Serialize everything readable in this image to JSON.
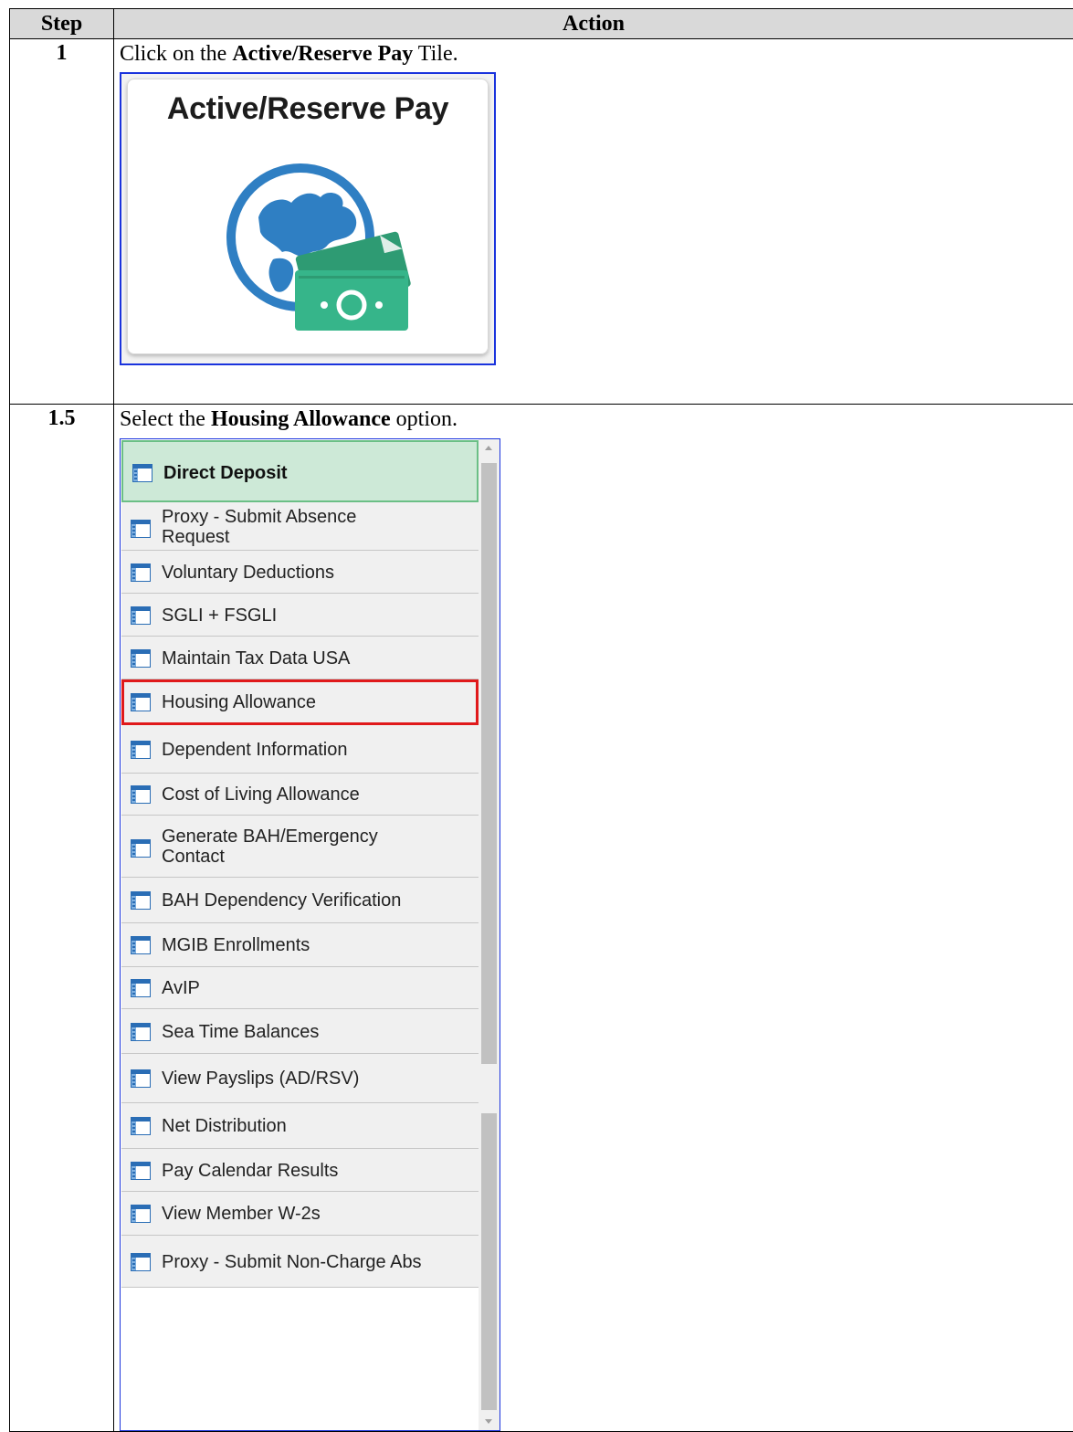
{
  "table": {
    "headers": {
      "step": "Step",
      "action": "Action"
    },
    "rows": [
      {
        "step": "1",
        "instruction": {
          "prefix": "Click on the ",
          "bold": "Active/Reserve Pay",
          "suffix": " Tile."
        },
        "tile": {
          "title": "Active/Reserve Pay",
          "icon": "globe-money-icon"
        }
      },
      {
        "step": "1.5",
        "instruction": {
          "prefix": "Select the ",
          "bold": "Housing Allowance",
          "suffix": " option."
        },
        "menu": {
          "items": [
            {
              "line1": "Direct Deposit",
              "line2": ""
            },
            {
              "line1": "Proxy - Submit Absence",
              "line2": "Request"
            },
            {
              "line1": "Voluntary Deductions",
              "line2": ""
            },
            {
              "line1": "SGLI + FSGLI",
              "line2": ""
            },
            {
              "line1": "Maintain Tax Data USA",
              "line2": ""
            },
            {
              "line1": "Housing Allowance",
              "line2": ""
            },
            {
              "line1": "Dependent Information",
              "line2": ""
            },
            {
              "line1": "Cost of Living Allowance",
              "line2": ""
            },
            {
              "line1": "Generate BAH/Emergency",
              "line2": "Contact"
            },
            {
              "line1": "BAH Dependency Verification",
              "line2": ""
            },
            {
              "line1": "MGIB Enrollments",
              "line2": ""
            },
            {
              "line1": "AvIP",
              "line2": ""
            },
            {
              "line1": "Sea Time Balances",
              "line2": ""
            },
            {
              "line1": "View Payslips (AD/RSV)",
              "line2": ""
            },
            {
              "line1": "Net Distribution",
              "line2": ""
            },
            {
              "line1": "Pay Calendar Results",
              "line2": ""
            },
            {
              "line1": "View Member W-2s",
              "line2": ""
            },
            {
              "line1": "Proxy - Submit Non-Charge Abs",
              "line2": ""
            }
          ],
          "selected": "Housing Allowance",
          "item_icon": "page-icon"
        }
      }
    ]
  },
  "colors": {
    "header_bg": "#d9d9d9",
    "highlight": "#e0191b",
    "frame_border": "#1a33dd",
    "first_item_bg": "#cde9d7",
    "globe_blue": "#2f7fc3",
    "money_green": "#36b58a"
  }
}
